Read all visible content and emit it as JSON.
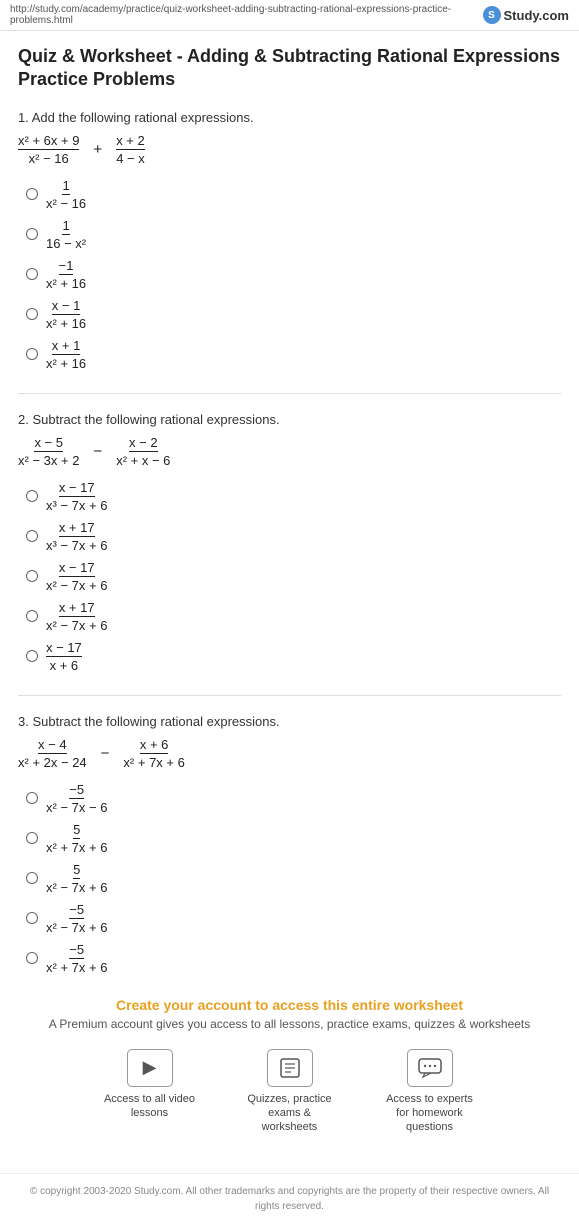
{
  "topbar": {
    "url": "http://study.com/academy/practice/quiz-worksheet-adding-subtracting-rational-expressions-practice-problems.html",
    "logo_icon": "S",
    "logo_text": "Study.com"
  },
  "page": {
    "title": "Quiz & Worksheet - Adding & Subtracting Rational Expressions Practice Problems"
  },
  "questions": [
    {
      "number": "1.",
      "label": "Add the following rational expressions.",
      "main_expr": {
        "frac1_num": "x² + 6x + 9",
        "frac1_den": "x² − 16",
        "operator": "+",
        "frac2_num": "x + 2",
        "frac2_den": "4 − x"
      },
      "options": [
        {
          "num": "1",
          "den": "x² − 16"
        },
        {
          "num": "1",
          "den": "16 − x²"
        },
        {
          "num": "−1",
          "den": "x² + 16"
        },
        {
          "num": "x − 1",
          "den": "x² + 16"
        },
        {
          "num": "x + 1",
          "den": "x² + 16"
        }
      ]
    },
    {
      "number": "2.",
      "label": "Subtract the following rational expressions.",
      "main_expr": {
        "frac1_num": "x − 5",
        "frac1_den": "x² − 3x + 2",
        "operator": "−",
        "frac2_num": "x − 2",
        "frac2_den": "x² + x − 6"
      },
      "options": [
        {
          "num": "x − 17",
          "den": "x³ − 7x + 6"
        },
        {
          "num": "x + 17",
          "den": "x³ − 7x + 6"
        },
        {
          "num": "x − 17",
          "den": "x² − 7x + 6"
        },
        {
          "num": "x + 17",
          "den": "x² − 7x + 6"
        },
        {
          "num": "x − 17",
          "den": "x + 6"
        }
      ]
    },
    {
      "number": "3.",
      "label": "Subtract the following rational expressions.",
      "main_expr": {
        "frac1_num": "x − 4",
        "frac1_den": "x² + 2x − 24",
        "operator": "−",
        "frac2_num": "x + 6",
        "frac2_den": "x² + 7x + 6"
      },
      "options": [
        {
          "num": "−5",
          "den": "x² − 7x − 6"
        },
        {
          "num": "5",
          "den": "x² + 7x + 6"
        },
        {
          "num": "5",
          "den": "x² − 7x + 6"
        },
        {
          "num": "−5",
          "den": "x² − 7x + 6"
        },
        {
          "num": "−5",
          "den": "x² + 7x + 6"
        }
      ]
    }
  ],
  "cta": {
    "title": "Create your account to access this entire worksheet",
    "subtitle": "A Premium account gives you access to all lessons, practice exams, quizzes & worksheets",
    "icons": [
      {
        "symbol": "▶",
        "label": "Access to all video lessons"
      },
      {
        "symbol": "📋",
        "label": "Quizzes, practice exams & worksheets"
      },
      {
        "symbol": "💬",
        "label": "Access to experts for homework questions"
      }
    ]
  },
  "footer": {
    "text": "© copyright 2003-2020 Study.com. All other trademarks and copyrights are the property of their respective owners. All rights reserved."
  }
}
